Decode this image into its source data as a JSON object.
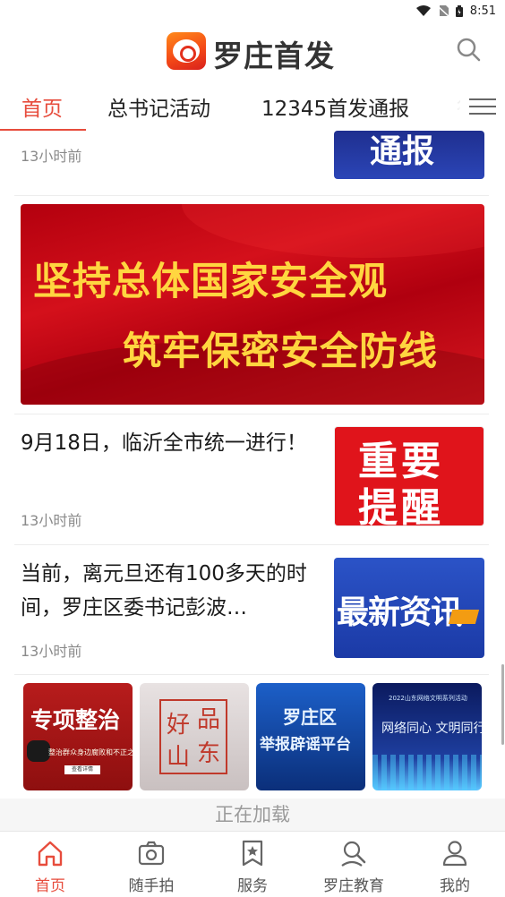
{
  "status_bar": {
    "time": "8:51"
  },
  "header": {
    "app_title": "罗庄首发"
  },
  "tabs": [
    {
      "label": "首页"
    },
    {
      "label": "总书记活动"
    },
    {
      "label": "12345首发通报"
    },
    {
      "label": "行"
    }
  ],
  "feed": {
    "item1": {
      "time": "13小时前",
      "thumb_text": "通报"
    },
    "banner": {
      "line1": "坚持总体国家安全观",
      "line2": "筑牢保密安全防线"
    },
    "item2": {
      "headline": "9月18日，临沂全市统一进行！",
      "time": "13小时前",
      "thumb_line1": "重要",
      "thumb_line2": "提醒"
    },
    "item3": {
      "headline": "当前，离元旦还有100多天的时间，罗庄区委书记彭波…",
      "time": "13小时前",
      "thumb_text": "最新资讯"
    },
    "promos": [
      {
        "title": "专项整治",
        "subtitle": "整治群众身边腐败和不正之风",
        "button": "查看详情"
      },
      {
        "c1": "好",
        "c2": "品",
        "c3": "山",
        "c4": "东"
      },
      {
        "line1": "罗庄区",
        "line2": "举报辟谣平台"
      },
      {
        "subtitle": "2022山东网络文明系列活动",
        "title": "网络同心 文明同行"
      }
    ],
    "loading": "正在加载"
  },
  "bottom_nav": [
    {
      "label": "首页",
      "icon": "home-icon"
    },
    {
      "label": "随手拍",
      "icon": "camera-icon"
    },
    {
      "label": "服务",
      "icon": "bookmark-star-icon"
    },
    {
      "label": "罗庄教育",
      "icon": "education-icon"
    },
    {
      "label": "我的",
      "icon": "user-icon"
    }
  ],
  "colors": {
    "accent": "#e74c3c",
    "text": "#222222",
    "muted": "#8a8a8a"
  }
}
